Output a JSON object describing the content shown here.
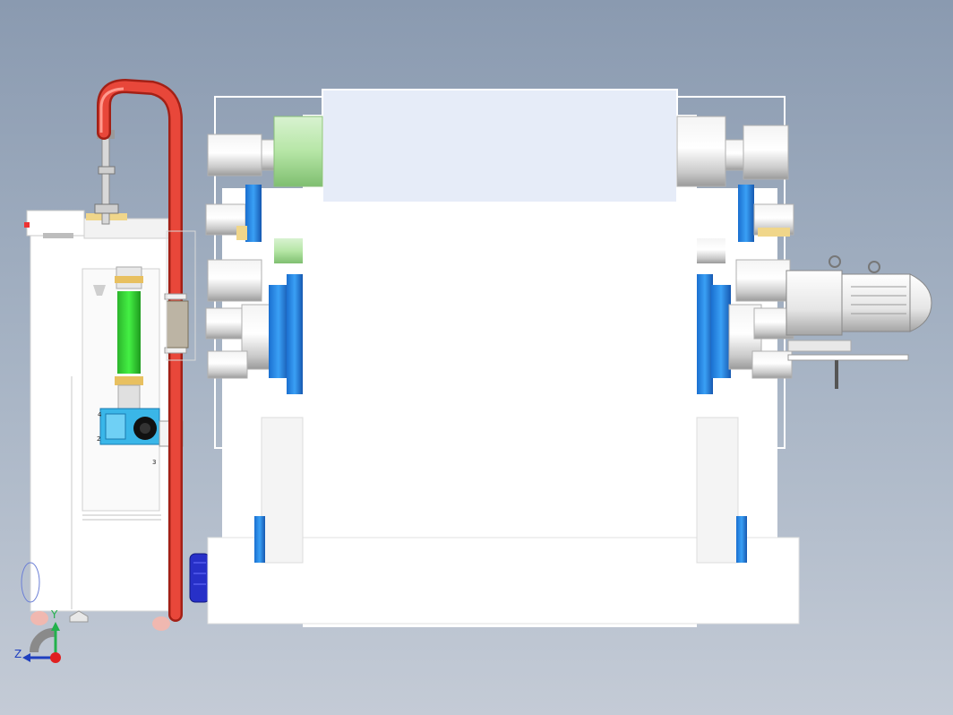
{
  "view": {
    "background_top": "#8a9ab0",
    "background_bottom": "#c4cbd6"
  },
  "callouts": {
    "c1": "4",
    "c2": "2",
    "c3": "3"
  },
  "triad": {
    "y_label": "Y",
    "z_label": "Z",
    "y_color": "#22b14c",
    "z_color": "#1f3fbf",
    "origin_color": "#e02020"
  },
  "colors": {
    "frame": "#ffffff",
    "pipe": "#e03a2e",
    "green_roller": "#2fd12f",
    "blue_part": "#2a8fe8",
    "cyan_gearbox": "#3ab6e8",
    "motor_blue": "#2730c8",
    "top_panel": "#e6ecf8"
  }
}
